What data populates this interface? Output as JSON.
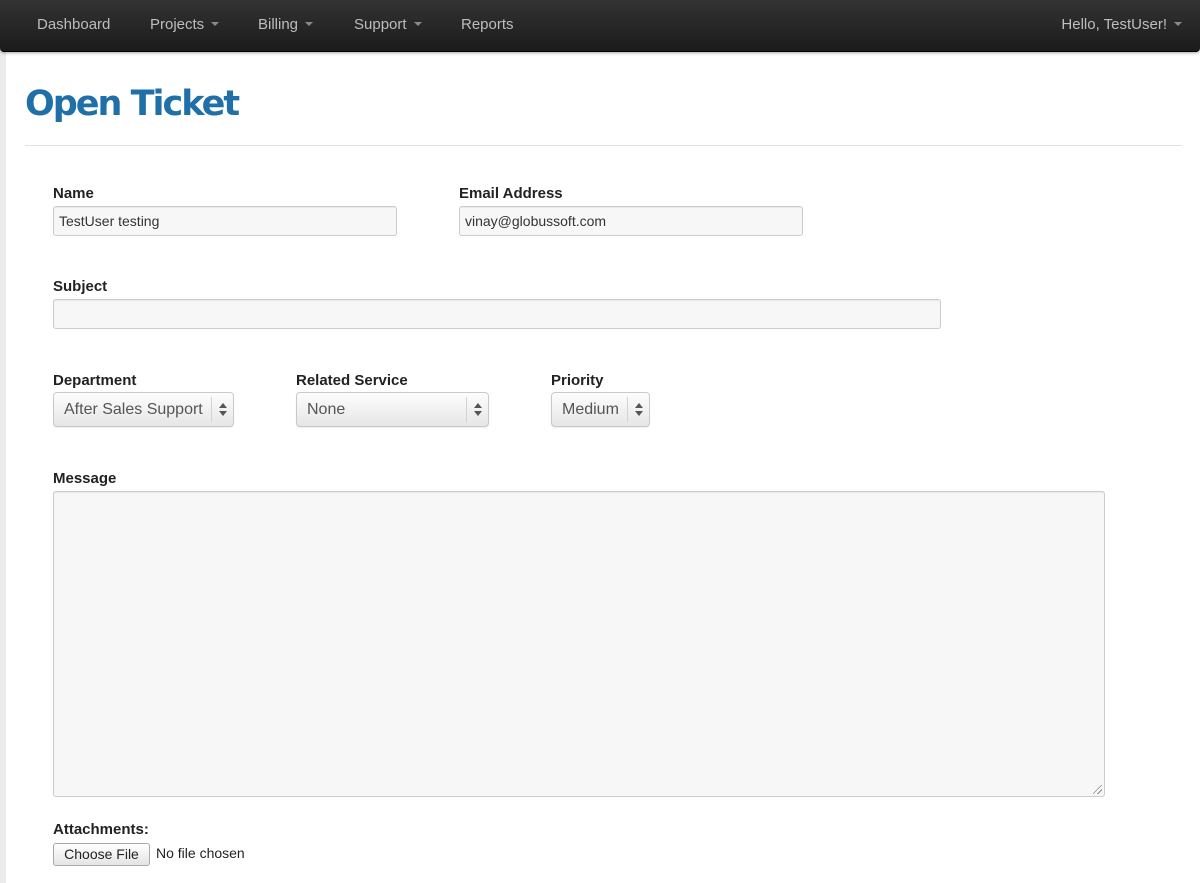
{
  "navbar": {
    "items": [
      {
        "label": "Dashboard",
        "has_dropdown": false
      },
      {
        "label": "Projects",
        "has_dropdown": true
      },
      {
        "label": "Billing",
        "has_dropdown": true
      },
      {
        "label": "Support",
        "has_dropdown": true
      },
      {
        "label": "Reports",
        "has_dropdown": false
      }
    ],
    "user_greeting": "Hello, TestUser!",
    "icons": [
      "caret-down-icon"
    ]
  },
  "page": {
    "title": "Open Ticket"
  },
  "form": {
    "name": {
      "label": "Name",
      "value": "TestUser testing"
    },
    "email": {
      "label": "Email Address",
      "value": "vinay@globussoft.com"
    },
    "subject": {
      "label": "Subject",
      "value": ""
    },
    "department": {
      "label": "Department",
      "selected": "After Sales Support"
    },
    "related_service": {
      "label": "Related Service",
      "selected": "None"
    },
    "priority": {
      "label": "Priority",
      "selected": "Medium"
    },
    "message": {
      "label": "Message",
      "value": ""
    },
    "attachments": {
      "label": "Attachments:",
      "button_label": "Choose File",
      "status": "No file chosen"
    }
  },
  "colors": {
    "navbar_bg": "#222222",
    "title": "#1f6fa8",
    "input_bg": "#f7f7f7"
  }
}
